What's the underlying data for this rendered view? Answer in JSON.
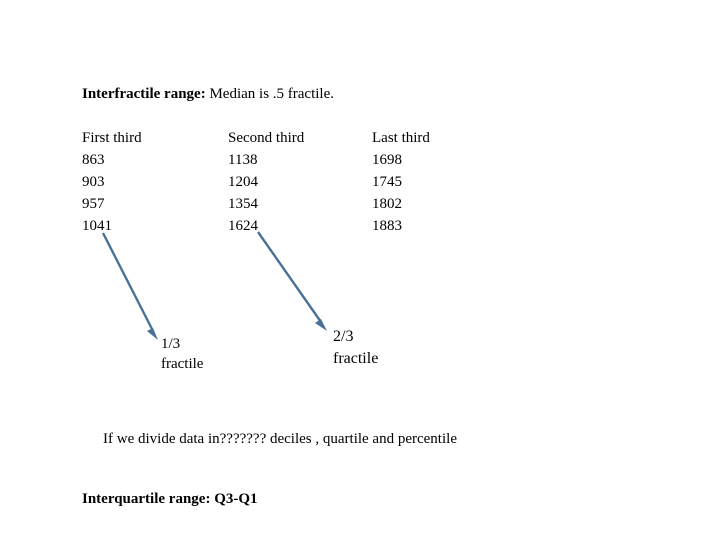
{
  "slide": {
    "background_color": "#FFFFFF",
    "text_color": "#000000",
    "arrow_color": "#4A7299"
  },
  "heading": {
    "lead": "Interfractile range:",
    "rest": " Median is .5 fractile."
  },
  "table": {
    "headers": [
      "First third",
      "Second third",
      "Last third"
    ],
    "rows": [
      [
        "863",
        "1138",
        "1698"
      ],
      [
        "903",
        "1204",
        "1745"
      ],
      [
        "957",
        "1354",
        "1802"
      ],
      [
        "1041",
        "1624",
        "1883"
      ]
    ]
  },
  "callouts": {
    "one_third": {
      "line1": "1/3",
      "line2": "fractile"
    },
    "two_thirds": {
      "line1": "2/3",
      "line2": "fractile"
    }
  },
  "body": {
    "divide_line": "If we divide data in??????? deciles , quartile and percentile",
    "interquartile_line": "Interquartile range: Q3-Q1"
  }
}
